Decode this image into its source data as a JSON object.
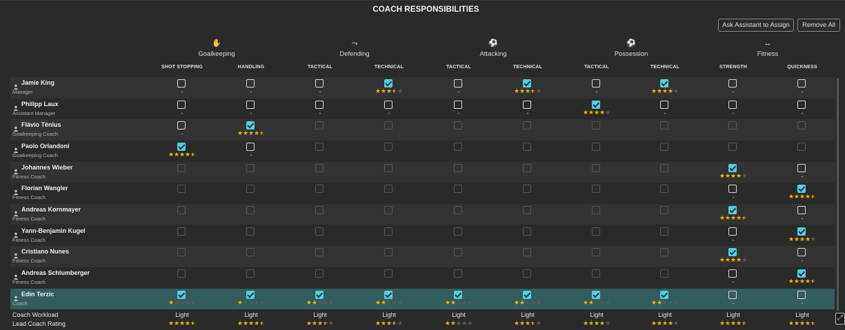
{
  "title": "COACH RESPONSIBILITIES",
  "buttons": {
    "assist": "Ask Assistant to Assign",
    "remove": "Remove All"
  },
  "groups": [
    {
      "label": "Goalkeeping",
      "icon": "goalkeeper-icon",
      "glyph": "✋"
    },
    {
      "label": "Defending",
      "icon": "tackle-icon",
      "glyph": "⤳"
    },
    {
      "label": "Attacking",
      "icon": "runner-icon",
      "glyph": "⚽"
    },
    {
      "label": "Possession",
      "icon": "dribble-icon",
      "glyph": "⚽"
    },
    {
      "label": "Fitness",
      "icon": "strength-icon",
      "glyph": "↔"
    }
  ],
  "columns": [
    "SHOT STOPPING",
    "HANDLING",
    "TACTICAL",
    "TECHNICAL",
    "TACTICAL",
    "TECHNICAL",
    "TACTICAL",
    "TECHNICAL",
    "STRENGTH",
    "QUICKNESS"
  ],
  "coaches": [
    {
      "name": "Jamie King",
      "role": "Manager",
      "enabled": [
        1,
        1,
        1,
        1,
        1,
        1,
        1,
        1,
        1,
        1
      ],
      "checked": [
        0,
        0,
        0,
        1,
        0,
        1,
        0,
        1,
        0,
        0
      ],
      "rating": [
        null,
        null,
        null,
        3.5,
        null,
        3.5,
        null,
        4,
        null,
        null
      ]
    },
    {
      "name": "Philipp Laux",
      "role": "Assistant Manager",
      "enabled": [
        1,
        1,
        1,
        1,
        1,
        1,
        1,
        1,
        1,
        1
      ],
      "checked": [
        0,
        0,
        0,
        0,
        0,
        0,
        1,
        0,
        0,
        0
      ],
      "rating": [
        null,
        null,
        null,
        null,
        null,
        null,
        4,
        null,
        null,
        null
      ]
    },
    {
      "name": "Flávio Tênius",
      "role": "Goalkeeping Coach",
      "enabled": [
        1,
        1,
        0,
        0,
        0,
        0,
        0,
        0,
        0,
        0
      ],
      "checked": [
        0,
        1,
        0,
        0,
        0,
        0,
        0,
        0,
        0,
        0
      ],
      "rating": [
        null,
        4.5,
        null,
        null,
        null,
        null,
        null,
        null,
        null,
        null
      ]
    },
    {
      "name": "Paolo Orlandoni",
      "role": "Goalkeeping Coach",
      "enabled": [
        1,
        1,
        0,
        0,
        0,
        0,
        0,
        0,
        0,
        0
      ],
      "checked": [
        1,
        0,
        0,
        0,
        0,
        0,
        0,
        0,
        0,
        0
      ],
      "rating": [
        4.5,
        null,
        null,
        null,
        null,
        null,
        null,
        null,
        null,
        null
      ]
    },
    {
      "name": "Johannes Wieber",
      "role": "Fitness Coach",
      "enabled": [
        0,
        0,
        0,
        0,
        0,
        0,
        0,
        0,
        1,
        1
      ],
      "checked": [
        0,
        0,
        0,
        0,
        0,
        0,
        0,
        0,
        1,
        0
      ],
      "rating": [
        null,
        null,
        null,
        null,
        null,
        null,
        null,
        null,
        4,
        null
      ]
    },
    {
      "name": "Florian Wangler",
      "role": "Fitness Coach",
      "enabled": [
        0,
        0,
        0,
        0,
        0,
        0,
        0,
        0,
        1,
        1
      ],
      "checked": [
        0,
        0,
        0,
        0,
        0,
        0,
        0,
        0,
        0,
        1
      ],
      "rating": [
        null,
        null,
        null,
        null,
        null,
        null,
        null,
        null,
        null,
        4.5
      ]
    },
    {
      "name": "Andreas Kornmayer",
      "role": "Fitness Coach",
      "enabled": [
        0,
        0,
        0,
        0,
        0,
        0,
        0,
        0,
        1,
        1
      ],
      "checked": [
        0,
        0,
        0,
        0,
        0,
        0,
        0,
        0,
        1,
        0
      ],
      "rating": [
        null,
        null,
        null,
        null,
        null,
        null,
        null,
        null,
        4.5,
        null
      ]
    },
    {
      "name": "Yann-Benjamin Kugel",
      "role": "Fitness Coach",
      "enabled": [
        0,
        0,
        0,
        0,
        0,
        0,
        0,
        0,
        1,
        1
      ],
      "checked": [
        0,
        0,
        0,
        0,
        0,
        0,
        0,
        0,
        0,
        1
      ],
      "rating": [
        null,
        null,
        null,
        null,
        null,
        null,
        null,
        null,
        null,
        4
      ]
    },
    {
      "name": "Cristiano Nunes",
      "role": "Fitness Coach",
      "enabled": [
        0,
        0,
        0,
        0,
        0,
        0,
        0,
        0,
        1,
        1
      ],
      "checked": [
        0,
        0,
        0,
        0,
        0,
        0,
        0,
        0,
        1,
        0
      ],
      "rating": [
        null,
        null,
        null,
        null,
        null,
        null,
        null,
        null,
        4,
        null
      ]
    },
    {
      "name": "Andreas Schlumberger",
      "role": "Fitness Coach",
      "enabled": [
        0,
        0,
        0,
        0,
        0,
        0,
        0,
        0,
        1,
        1
      ],
      "checked": [
        0,
        0,
        0,
        0,
        0,
        0,
        0,
        0,
        0,
        1
      ],
      "rating": [
        null,
        null,
        null,
        null,
        null,
        null,
        null,
        null,
        null,
        4.5
      ]
    },
    {
      "name": "Edin Terzic",
      "role": "Coach",
      "enabled": [
        1,
        1,
        1,
        1,
        1,
        1,
        1,
        1,
        1,
        1
      ],
      "checked": [
        1,
        1,
        1,
        1,
        1,
        1,
        1,
        1,
        0,
        0
      ],
      "rating": [
        1,
        1,
        2,
        2,
        2,
        2,
        2,
        2,
        null,
        null
      ]
    }
  ],
  "selected_row": 9,
  "dash": "-",
  "footer": {
    "workload_label": "Coach Workload",
    "rating_label": "Lead Coach Rating",
    "workload": [
      "Light",
      "Light",
      "Light",
      "Light",
      "Light",
      "Light",
      "Light",
      "Light",
      "Light",
      "Light"
    ],
    "lead_rating": [
      4.5,
      4.5,
      3.5,
      3.5,
      2,
      3.5,
      4,
      4,
      4.5,
      4.5
    ]
  },
  "colors": {
    "accent": "#4fd0e0",
    "star": "#f5b700",
    "selected_row": "#335c5c"
  }
}
